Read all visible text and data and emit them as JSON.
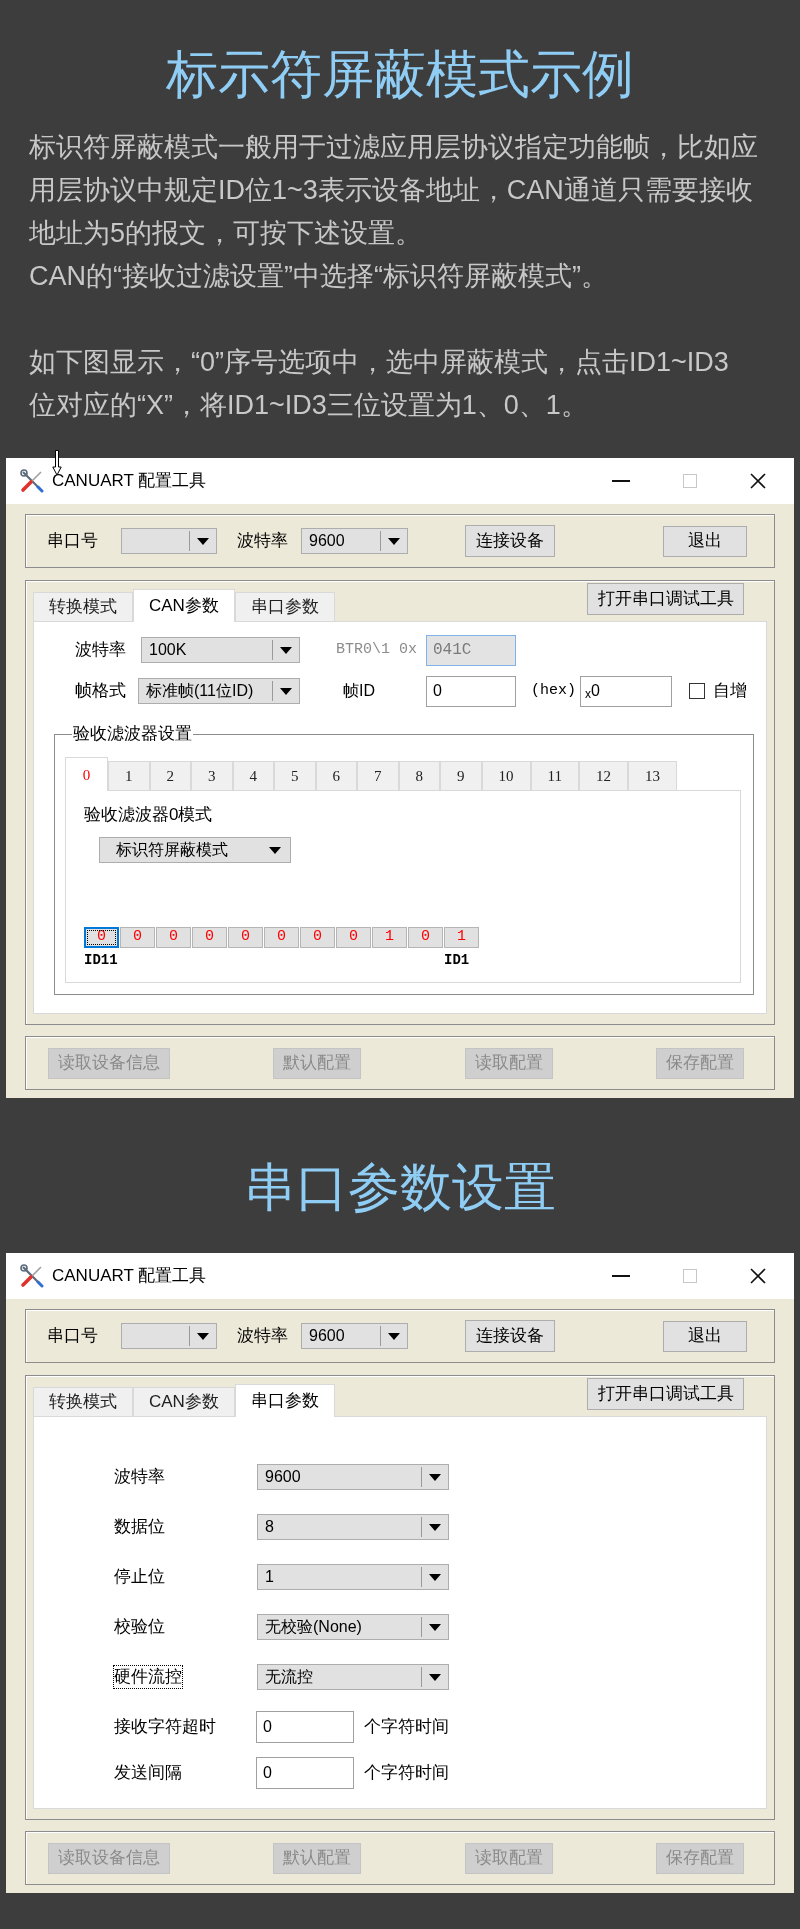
{
  "sections": [
    {
      "heading": "标示符屏蔽模式示例",
      "paragraphs": [
        "标识符屏蔽模式一般用于过滤应用层协议指定功能帧，比如应用层协议中规定ID位1~3表示设备地址，CAN通道只需要接收地址为5的报文，可按下述设置。",
        "CAN的“接收过滤设置”中选择“标识符屏蔽模式”。",
        "如下图显示，“0”序号选项中，选中屏蔽模式，点击ID1~ID3位对应的“X”，将ID1~ID3三位设置为1、0、1。"
      ],
      "window": {
        "title": "CANUART 配置工具",
        "toolbar": {
          "port_label": "串口号",
          "baud_label": "波特率",
          "baud_value": "9600",
          "connect_button": "连接设备",
          "exit_button": "退出"
        },
        "tabs": [
          {
            "label": "转换模式",
            "selected": false
          },
          {
            "label": "CAN参数",
            "selected": true
          },
          {
            "label": "串口参数",
            "selected": false
          }
        ],
        "debug_button": "打开串口调试工具",
        "panel": {
          "kind": "can",
          "baud_label": "波特率",
          "baud_value": "100K",
          "btr_label": "BTR0\\1 0x",
          "btr_value": "041C",
          "btr_disabled": true,
          "frame_label": "帧格式",
          "frame_value": "标准帧(11位ID)",
          "id_label": "帧ID",
          "id_value": "0",
          "hex_label": "(hex)",
          "hex_value": "$_{x}$0",
          "auto_increment": {
            "label": "自增",
            "checked": false
          },
          "filter_group": {
            "title": "验收滤波器设置",
            "tabs": [
              {
                "label": "0",
                "selected": true
              },
              {
                "label": "1",
                "selected": false
              },
              {
                "label": "2",
                "selected": false
              },
              {
                "label": "3",
                "selected": false
              },
              {
                "label": "4",
                "selected": false
              },
              {
                "label": "5",
                "selected": false
              },
              {
                "label": "6",
                "selected": false
              },
              {
                "label": "7",
                "selected": false
              },
              {
                "label": "8",
                "selected": false
              },
              {
                "label": "9",
                "selected": false
              },
              {
                "label": "10",
                "selected": false
              },
              {
                "label": "11",
                "selected": false
              },
              {
                "label": "12",
                "selected": false
              },
              {
                "label": "13",
                "selected": false
              }
            ],
            "mode_label": "验收滤波器0模式",
            "mode_value": "标识符屏蔽模式",
            "bits": [
              {
                "value": "0",
                "selected": true
              },
              {
                "value": "0",
                "selected": false
              },
              {
                "value": "0",
                "selected": false
              },
              {
                "value": "0",
                "selected": false
              },
              {
                "value": "0",
                "selected": false
              },
              {
                "value": "0",
                "selected": false
              },
              {
                "value": "0",
                "selected": false
              },
              {
                "value": "0",
                "selected": false
              },
              {
                "value": "1",
                "selected": false
              },
              {
                "value": "0",
                "selected": false
              },
              {
                "value": "1",
                "selected": false
              }
            ],
            "first_bit_label": "ID11",
            "last_bit_label": "ID1"
          }
        },
        "bottom_buttons": [
          {
            "label": "读取设备信息",
            "disabled": true
          },
          {
            "label": "默认配置",
            "disabled": true
          },
          {
            "label": "读取配置",
            "disabled": true
          },
          {
            "label": "保存配置",
            "disabled": true
          }
        ]
      }
    },
    {
      "heading": "串口参数设置",
      "window": {
        "title": "CANUART 配置工具",
        "toolbar": {
          "port_label": "串口号",
          "baud_label": "波特率",
          "baud_value": "9600",
          "connect_button": "连接设备",
          "exit_button": "退出"
        },
        "tabs": [
          {
            "label": "转换模式",
            "selected": false
          },
          {
            "label": "CAN参数",
            "selected": false
          },
          {
            "label": "串口参数",
            "selected": true
          }
        ],
        "debug_button": "打开串口调试工具",
        "panel": {
          "kind": "serial",
          "rows": [
            {
              "kind": "select",
              "label": "波特率",
              "value": "9600",
              "focused": false
            },
            {
              "kind": "select",
              "label": "数据位",
              "value": "8",
              "focused": false
            },
            {
              "kind": "select",
              "label": "停止位",
              "value": "1",
              "focused": false
            },
            {
              "kind": "select",
              "label": "校验位",
              "value": "无校验(None)",
              "focused": false
            },
            {
              "kind": "select",
              "label": "硬件流控",
              "value": "无流控",
              "focused": true
            },
            {
              "kind": "input",
              "label": "接收字符超时",
              "value": "0",
              "unit": "个字符时间",
              "focused": false
            },
            {
              "kind": "input",
              "label": "发送间隔",
              "value": "0",
              "unit": "个字符时间",
              "focused": false
            }
          ]
        },
        "bottom_buttons": [
          {
            "label": "读取设备信息",
            "disabled": true
          },
          {
            "label": "默认配置",
            "disabled": true
          },
          {
            "label": "读取配置",
            "disabled": true
          },
          {
            "label": "保存配置",
            "disabled": true
          }
        ]
      }
    }
  ]
}
